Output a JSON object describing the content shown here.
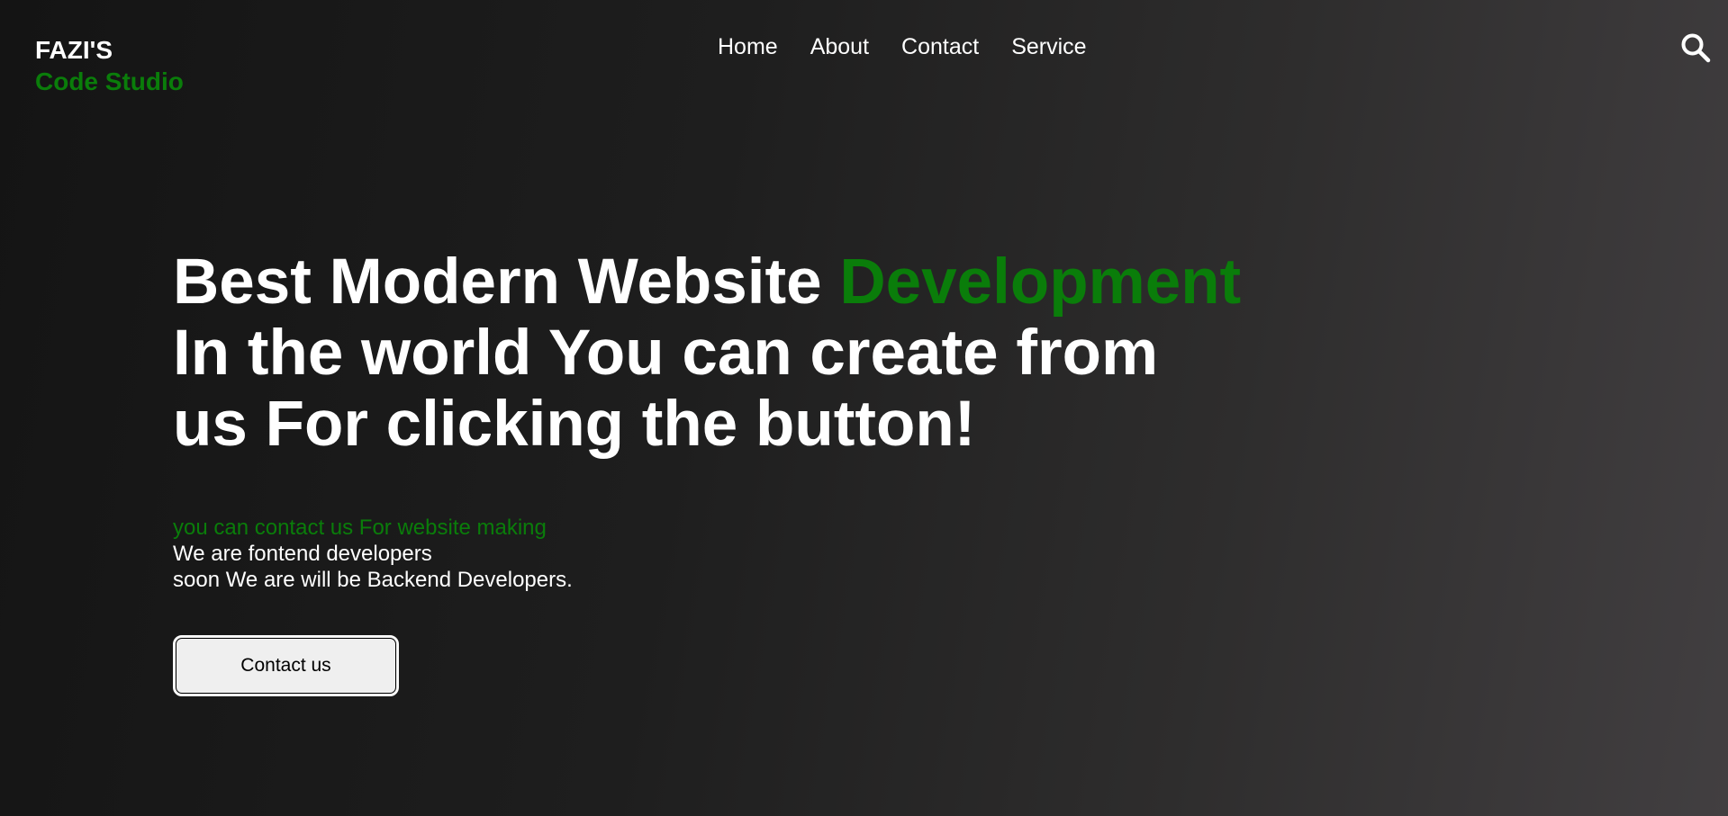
{
  "brand": {
    "line1": "FAZI'S",
    "line2": "Code Studio"
  },
  "nav": {
    "items": [
      {
        "label": "Home"
      },
      {
        "label": "About"
      },
      {
        "label": "Contact"
      },
      {
        "label": "Service"
      }
    ],
    "search_icon": "search-icon"
  },
  "hero": {
    "headline_part1": "Best Modern Website ",
    "headline_accent": "Development",
    "headline_part2": "In the world You can create from",
    "headline_part3": "us For clicking the button!"
  },
  "description": {
    "line1": "you can contact us For website making",
    "line2": "We are fontend developers",
    "line3": "soon We are will be Backend Developers."
  },
  "cta": {
    "label": "Contact us"
  },
  "colors": {
    "accent": "#0a7d0a",
    "text": "#ffffff",
    "button_bg": "#efefef"
  }
}
